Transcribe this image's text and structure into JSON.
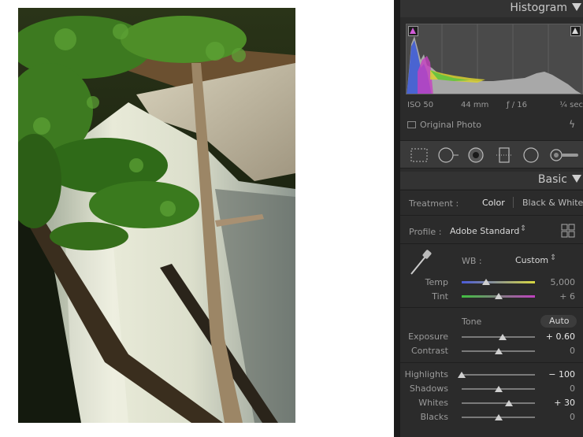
{
  "histogram": {
    "title": "Histogram",
    "exif": {
      "iso": "ISO 50",
      "focal": "44 mm",
      "aperture": "ƒ / 16",
      "shutter": "¼ sec"
    },
    "original_photo_label": "Original Photo",
    "clip_shadow_color": "#d25cd8",
    "clip_highlight_color": "#d8d8d8"
  },
  "basic": {
    "title": "Basic",
    "treatment": {
      "label": "Treatment :",
      "options": [
        "Color",
        "Black & White"
      ],
      "selected": "Color"
    },
    "profile": {
      "label": "Profile :",
      "value": "Adobe Standard",
      "icon": "grid-icon"
    },
    "wb": {
      "label": "WB :",
      "value": "Custom",
      "temp_label": "Temp",
      "temp_value": "5,000",
      "tint_label": "Tint",
      "tint_value": "+ 6"
    },
    "tone": {
      "label": "Tone",
      "auto": "Auto"
    },
    "sliders": [
      {
        "label": "Exposure",
        "value": "+ 0.60",
        "pos": 0.56,
        "highlight": true
      },
      {
        "label": "Contrast",
        "value": "0",
        "pos": 0.5,
        "highlight": false
      },
      {
        "label": "Highlights",
        "value": "− 100",
        "pos": 0.0,
        "highlight": true
      },
      {
        "label": "Shadows",
        "value": "0",
        "pos": 0.5,
        "highlight": false
      },
      {
        "label": "Whites",
        "value": "+ 30",
        "pos": 0.65,
        "highlight": true
      },
      {
        "label": "Blacks",
        "value": "0",
        "pos": 0.5,
        "highlight": false
      }
    ],
    "temp_pos": 0.33,
    "tint_pos": 0.51
  }
}
